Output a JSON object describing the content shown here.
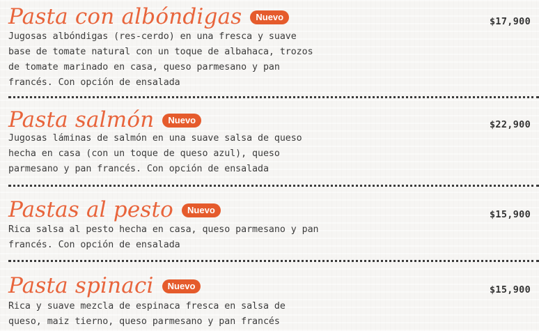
{
  "menu": {
    "items": [
      {
        "title": "Pasta con albóndigas",
        "badge": "Nuevo",
        "price": "$17,900",
        "description": "Jugosas albóndigas (res-cerdo) en una fresca y suave base de tomate natural con un toque de albahaca, trozos de tomate marinado en casa, queso parmesano y pan francés. Con opción de ensalada"
      },
      {
        "title": "Pasta salmón",
        "badge": "Nuevo",
        "price": "$22,900",
        "description": "Jugosas láminas de salmón en una suave salsa de queso hecha en casa (con un toque de queso azul), queso parmesano y pan francés. Con opción de ensalada"
      },
      {
        "title": "Pastas al pesto",
        "badge": "Nuevo",
        "price": "$15,900",
        "description": "Rica salsa al pesto hecha en casa, queso parmesano y pan francés. Con opción de ensalada"
      },
      {
        "title": "Pasta spinaci",
        "badge": "Nuevo",
        "price": "$15,900",
        "description": "Rica y suave mezcla de espinaca fresca en salsa de queso, maiz tierno, queso parmesano y pan francés"
      }
    ]
  },
  "colors": {
    "title": "#e8643b",
    "badge_bg": "#e55b2c",
    "text": "#3b3b3b",
    "background": "#f6f5f3"
  }
}
